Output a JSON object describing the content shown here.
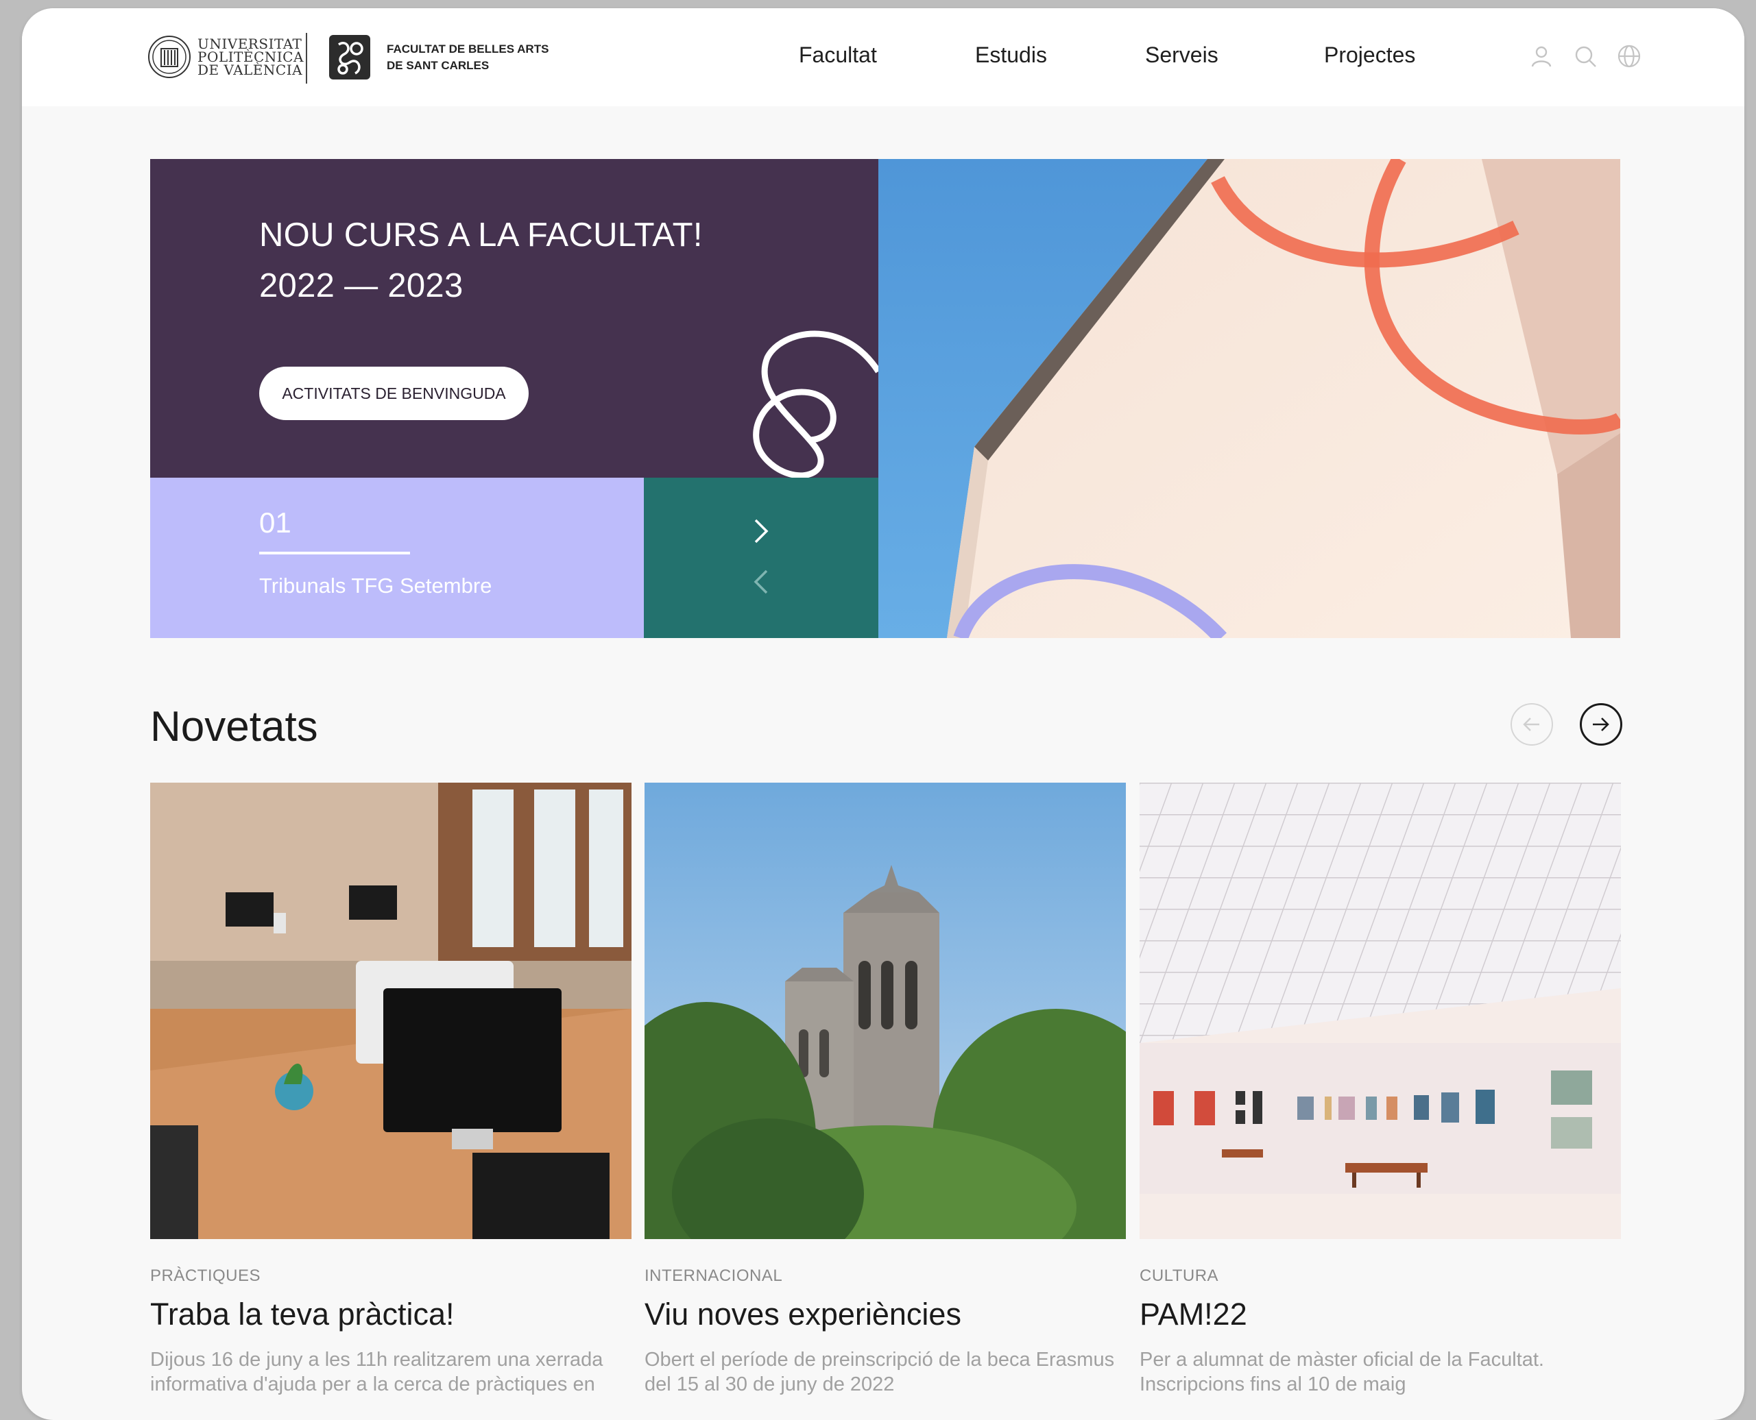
{
  "header": {
    "upv_logo_text": [
      "UNIVERSITAT",
      "POLITÈCNICA",
      "DE VALÈNCIA"
    ],
    "faculty_logo_text": [
      "FACULTAT DE BELLES ARTS",
      "DE SANT CARLES"
    ],
    "nav": [
      "Facultat",
      "Estudis",
      "Serveis",
      "Projectes"
    ],
    "icons": [
      "user-icon",
      "search-icon",
      "globe-icon"
    ]
  },
  "hero": {
    "title_line1": "NOU CURS A LA FACULTAT!",
    "title_line2": "2022 — 2023",
    "button_label": "ACTIVITATS DE BENVINGUDA",
    "slide_number": "01",
    "slide_title": "Tribunals TFG Setembre",
    "colors": {
      "purple": "#45324f",
      "lavender": "#bdbcfb",
      "teal": "#23726e",
      "coral": "#f06b4f"
    }
  },
  "news": {
    "title": "Novetats",
    "cards": [
      {
        "category": "PRÀCTIQUES",
        "title": "Traba la teva pràctica!",
        "description": "Dijous 16 de juny a les 11h realitzarem una xerrada informativa d'ajuda per a la cerca de pràctiques en"
      },
      {
        "category": "INTERNACIONAL",
        "title": "Viu noves experiències",
        "description": "Obert el període de preinscripció de la beca Erasmus del 15 al 30 de juny de 2022"
      },
      {
        "category": "CULTURA",
        "title": "PAM!22",
        "description": "Per a alumnat de màster oficial de la Facultat. Inscripcions fins al 10 de maig"
      }
    ]
  }
}
